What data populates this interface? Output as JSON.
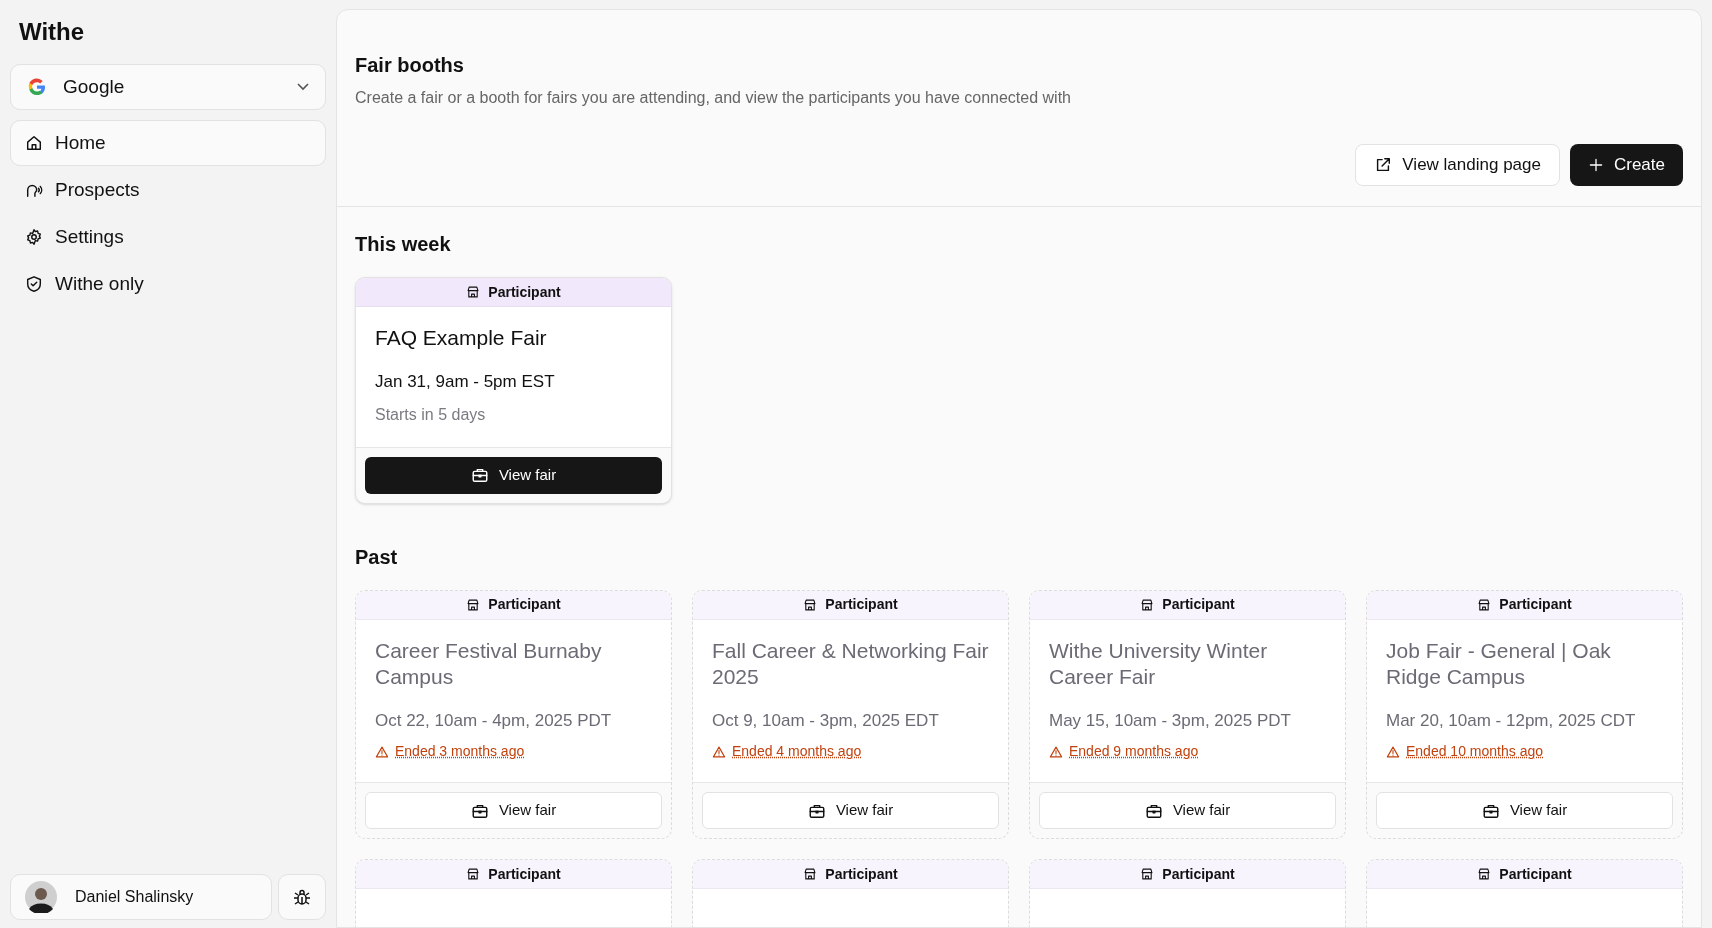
{
  "sidebar": {
    "brand": "Withe",
    "org_switcher": {
      "label": "Google"
    },
    "items": [
      {
        "label": "Home",
        "kind": "home",
        "selected": true
      },
      {
        "label": "Prospects",
        "kind": "prospects",
        "selected": false
      },
      {
        "label": "Settings",
        "kind": "settings",
        "selected": false
      },
      {
        "label": "Withe only",
        "kind": "restricted",
        "selected": false
      }
    ],
    "user": {
      "name": "Daniel Shalinsky"
    }
  },
  "header": {
    "title": "Fair booths",
    "subtitle": "Create a fair or a booth for fairs you are attending, and view the participants you have connected with",
    "buttons": [
      {
        "label": "View landing page",
        "kind": "secondary"
      },
      {
        "label": "Create",
        "kind": "primary"
      }
    ]
  },
  "sections": [
    {
      "title": "This week",
      "cards": [
        {
          "role": "Participant",
          "title": "FAQ Example Fair",
          "date": "Jan 31, 9am - 5pm EST",
          "status": "Starts in 5 days",
          "ended": false,
          "button": "View fair"
        }
      ]
    },
    {
      "title": "Past",
      "cards": [
        {
          "role": "Participant",
          "title": "Career Festival Burnaby Campus",
          "date": "Oct 22, 10am - 4pm, 2025 PDT",
          "status": "Ended 3 months ago",
          "ended": true,
          "button": "View fair"
        },
        {
          "role": "Participant",
          "title": "Fall Career & Networking Fair 2025",
          "date": "Oct 9, 10am - 3pm, 2025 EDT",
          "status": "Ended 4 months ago",
          "ended": true,
          "button": "View fair"
        },
        {
          "role": "Participant",
          "title": "Withe University Winter Career Fair",
          "date": "May 15, 10am - 3pm, 2025 PDT",
          "status": "Ended 9 months ago",
          "ended": true,
          "button": "View fair"
        },
        {
          "role": "Participant",
          "title": "Job Fair - General | Oak Ridge Campus",
          "date": "Mar 20, 10am - 12pm, 2025 CDT",
          "status": "Ended 10 months ago",
          "ended": true,
          "button": "View fair"
        },
        {
          "role": "Participant",
          "ended": true
        },
        {
          "role": "Participant",
          "ended": true
        },
        {
          "role": "Participant",
          "ended": true
        },
        {
          "role": "Participant",
          "ended": true
        }
      ]
    }
  ]
}
